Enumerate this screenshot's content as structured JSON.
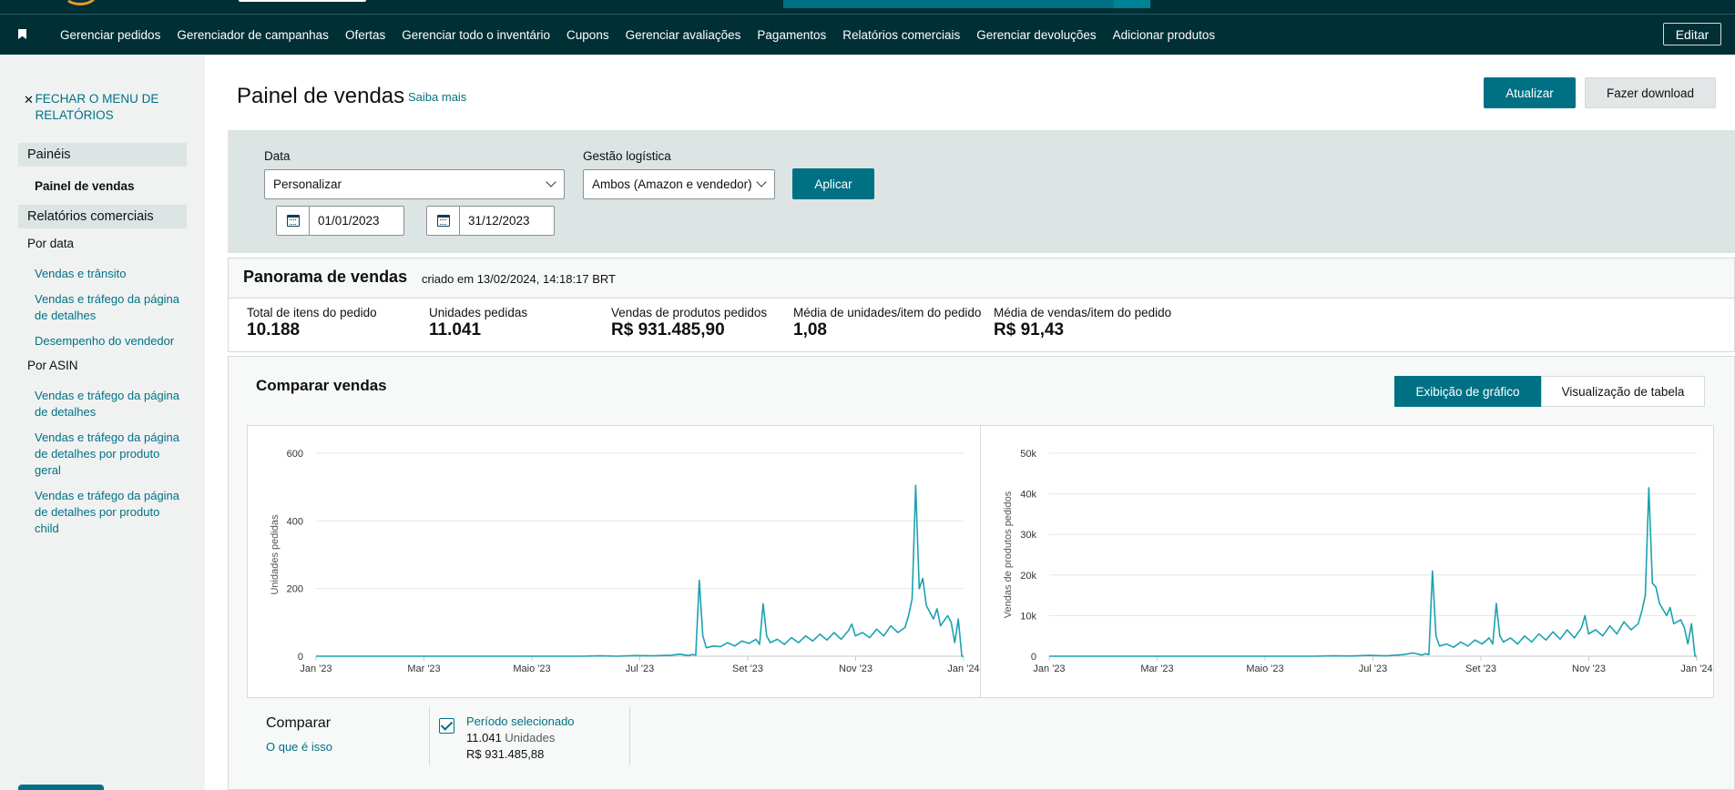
{
  "nav": {
    "items": [
      "Gerenciar pedidos",
      "Gerenciador de campanhas",
      "Ofertas",
      "Gerenciar todo o inventário",
      "Cupons",
      "Gerenciar avaliações",
      "Pagamentos",
      "Relatórios comerciais",
      "Gerenciar devoluções",
      "Adicionar produtos"
    ],
    "edit_label": "Editar"
  },
  "sidebar": {
    "close_menu": "FECHAR O MENU DE RELATÓRIOS",
    "section_panels": "Painéis",
    "active_item": "Painel de vendas",
    "section_reports": "Relatórios comerciais",
    "by_date": "Por data",
    "date_links": [
      "Vendas e trânsito",
      "Vendas e tráfego da página de detalhes",
      "Desempenho do vendedor"
    ],
    "by_asin": "Por ASIN",
    "asin_links": [
      "Vendas e tráfego da página de detalhes",
      "Vendas e tráfego da página de detalhes por produto geral",
      "Vendas e tráfego da página de detalhes por produto child"
    ]
  },
  "header": {
    "title": "Painel de vendas",
    "learn_more": "Saiba mais",
    "refresh": "Atualizar",
    "download": "Fazer download"
  },
  "filters": {
    "date_label": "Data",
    "date_value": "Personalizar",
    "logistics_label": "Gestão logística",
    "logistics_value": "Ambos (Amazon e vendedor)",
    "apply": "Aplicar",
    "start_date": "01/01/2023",
    "end_date": "31/12/2023"
  },
  "overview": {
    "title": "Panorama de vendas",
    "created": "criado em 13/02/2024, 14:18:17 BRT",
    "metrics": [
      {
        "label": "Total de itens do pedido",
        "value": "10.188"
      },
      {
        "label": "Unidades pedidas",
        "value": "11.041"
      },
      {
        "label": "Vendas de produtos pedidos",
        "value": "R$ 931.485,90"
      },
      {
        "label": "Média de unidades/item do pedido",
        "value": "1,08"
      },
      {
        "label": "Média de vendas/item do pedido",
        "value": "R$ 91,43"
      }
    ]
  },
  "compare": {
    "title": "Comparar vendas",
    "view_chart": "Exibição de gráfico",
    "view_table": "Visualização de tabela",
    "footer_title": "Comparar",
    "footer_link": "O que é isso",
    "period_label": "Período selecionado",
    "period_units_value": "11.041",
    "period_units_word": "Unidades",
    "period_sales": "R$ 931.485,88"
  },
  "colors": {
    "accent": "#007185",
    "line": "#1ba2b0",
    "nav_bg": "#002f36"
  },
  "chart_data": [
    {
      "type": "line",
      "title": "",
      "ylabel": "Unidades pedidas",
      "ylim": [
        0,
        600
      ],
      "yticks": [
        "0",
        "200",
        "400",
        "600"
      ],
      "xticks": [
        "Jan '23",
        "Mar '23",
        "Maio '23",
        "Jul '23",
        "Set '23",
        "Nov '23",
        "Jan '24"
      ],
      "x_range_days": [
        0,
        365
      ],
      "series": [
        {
          "values": [
            [
              0,
              0
            ],
            [
              75,
              0
            ],
            [
              150,
              0
            ],
            [
              160,
              1
            ],
            [
              170,
              0
            ],
            [
              180,
              2
            ],
            [
              190,
              1
            ],
            [
              200,
              3
            ],
            [
              205,
              6
            ],
            [
              210,
              2
            ],
            [
              212,
              5
            ],
            [
              214,
              3
            ],
            [
              216,
              225
            ],
            [
              218,
              60
            ],
            [
              220,
              25
            ],
            [
              224,
              30
            ],
            [
              228,
              28
            ],
            [
              232,
              40
            ],
            [
              236,
              30
            ],
            [
              240,
              45
            ],
            [
              244,
              38
            ],
            [
              248,
              50
            ],
            [
              250,
              35
            ],
            [
              252,
              155
            ],
            [
              254,
              60
            ],
            [
              256,
              40
            ],
            [
              260,
              50
            ],
            [
              264,
              35
            ],
            [
              268,
              55
            ],
            [
              272,
              40
            ],
            [
              276,
              60
            ],
            [
              280,
              45
            ],
            [
              284,
              65
            ],
            [
              288,
              48
            ],
            [
              292,
              70
            ],
            [
              296,
              50
            ],
            [
              300,
              75
            ],
            [
              302,
              95
            ],
            [
              304,
              60
            ],
            [
              308,
              70
            ],
            [
              312,
              55
            ],
            [
              316,
              80
            ],
            [
              320,
              60
            ],
            [
              324,
              90
            ],
            [
              328,
              70
            ],
            [
              332,
              85
            ],
            [
              334,
              120
            ],
            [
              336,
              170
            ],
            [
              338,
              505
            ],
            [
              340,
              200
            ],
            [
              342,
              230
            ],
            [
              344,
              150
            ],
            [
              348,
              110
            ],
            [
              350,
              140
            ],
            [
              352,
              90
            ],
            [
              356,
              120
            ],
            [
              358,
              100
            ],
            [
              360,
              40
            ],
            [
              362,
              110
            ],
            [
              364,
              0
            ],
            [
              365,
              0
            ]
          ]
        }
      ]
    },
    {
      "type": "line",
      "title": "",
      "ylabel": "Vendas de produtos pedidos",
      "ylim": [
        0,
        50000
      ],
      "yticks": [
        "0",
        "10k",
        "20k",
        "30k",
        "40k",
        "50k"
      ],
      "xticks": [
        "Jan '23",
        "Mar '23",
        "Maio '23",
        "Jul '23",
        "Set '23",
        "Nov '23",
        "Jan '24"
      ],
      "x_range_days": [
        0,
        365
      ],
      "series": [
        {
          "values": [
            [
              0,
              0
            ],
            [
              150,
              0
            ],
            [
              160,
              100
            ],
            [
              170,
              50
            ],
            [
              180,
              200
            ],
            [
              190,
              100
            ],
            [
              200,
              400
            ],
            [
              205,
              800
            ],
            [
              210,
              300
            ],
            [
              212,
              600
            ],
            [
              214,
              400
            ],
            [
              216,
              21000
            ],
            [
              218,
              5000
            ],
            [
              220,
              2500
            ],
            [
              224,
              3000
            ],
            [
              228,
              2200
            ],
            [
              232,
              3500
            ],
            [
              236,
              2500
            ],
            [
              240,
              4000
            ],
            [
              244,
              3000
            ],
            [
              248,
              4500
            ],
            [
              250,
              3000
            ],
            [
              252,
              13000
            ],
            [
              254,
              5000
            ],
            [
              256,
              3500
            ],
            [
              260,
              4500
            ],
            [
              264,
              3000
            ],
            [
              268,
              5000
            ],
            [
              272,
              3500
            ],
            [
              276,
              5500
            ],
            [
              280,
              4000
            ],
            [
              284,
              6000
            ],
            [
              288,
              4200
            ],
            [
              292,
              6500
            ],
            [
              296,
              4500
            ],
            [
              300,
              7000
            ],
            [
              302,
              10000
            ],
            [
              304,
              5500
            ],
            [
              308,
              6500
            ],
            [
              312,
              5000
            ],
            [
              316,
              7500
            ],
            [
              320,
              5500
            ],
            [
              324,
              8500
            ],
            [
              328,
              6500
            ],
            [
              332,
              8000
            ],
            [
              334,
              11000
            ],
            [
              336,
              15000
            ],
            [
              338,
              41500
            ],
            [
              340,
              18000
            ],
            [
              342,
              17000
            ],
            [
              344,
              13000
            ],
            [
              348,
              10000
            ],
            [
              350,
              12000
            ],
            [
              352,
              8000
            ],
            [
              356,
              9000
            ],
            [
              358,
              7000
            ],
            [
              360,
              3000
            ],
            [
              362,
              8000
            ],
            [
              364,
              0
            ],
            [
              365,
              0
            ]
          ]
        }
      ]
    }
  ]
}
